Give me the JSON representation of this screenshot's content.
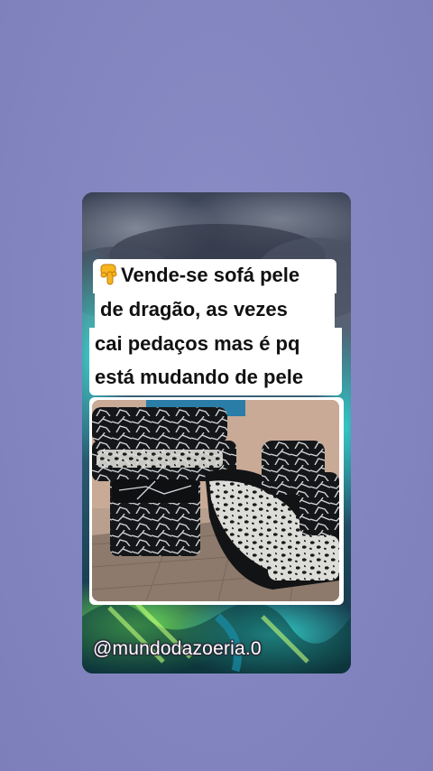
{
  "post": {
    "caption_lines": [
      "Vende-se sofá pele",
      "de dragão, as vezes",
      "cai pedaços mas é pq",
      "está mudando de pele"
    ],
    "leading_icon": "backhand-index-pointing-down-emoji",
    "photo_subject": "leopard-print cracked leather sofa set with ottoman",
    "watermark": "@mundodazoeria.0"
  },
  "colors": {
    "page_background": "#8486c2",
    "caption_background": "#ffffff",
    "caption_text": "#111111",
    "watermark_text": "#ffffff"
  }
}
